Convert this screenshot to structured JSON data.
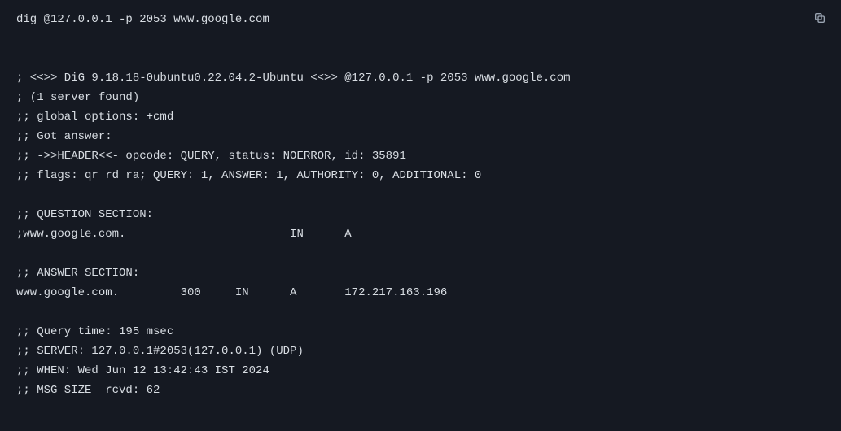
{
  "command": "dig @127.0.0.1 -p 2053 www.google.com",
  "version_line": "; <<>> DiG 9.18.18-0ubuntu0.22.04.2-Ubuntu <<>> @127.0.0.1 -p 2053 www.google.com",
  "servers_found": "; (1 server found)",
  "global_options": ";; global options: +cmd",
  "got_answer": ";; Got answer:",
  "header_line": ";; ->>HEADER<<- opcode: QUERY, status: NOERROR, id: 35891",
  "flags_line": ";; flags: qr rd ra; QUERY: 1, ANSWER: 1, AUTHORITY: 0, ADDITIONAL: 0",
  "question_header": ";; QUESTION SECTION:",
  "question_row": ";www.google.com.                        IN      A",
  "answer_header": ";; ANSWER SECTION:",
  "answer_row": "www.google.com.         300     IN      A       172.217.163.196",
  "query_time": ";; Query time: 195 msec",
  "server_line": ";; SERVER: 127.0.0.1#2053(127.0.0.1) (UDP)",
  "when_line": ";; WHEN: Wed Jun 12 13:42:43 IST 2024",
  "msg_size": ";; MSG SIZE  rcvd: 62",
  "copy_icon": "copy-icon"
}
